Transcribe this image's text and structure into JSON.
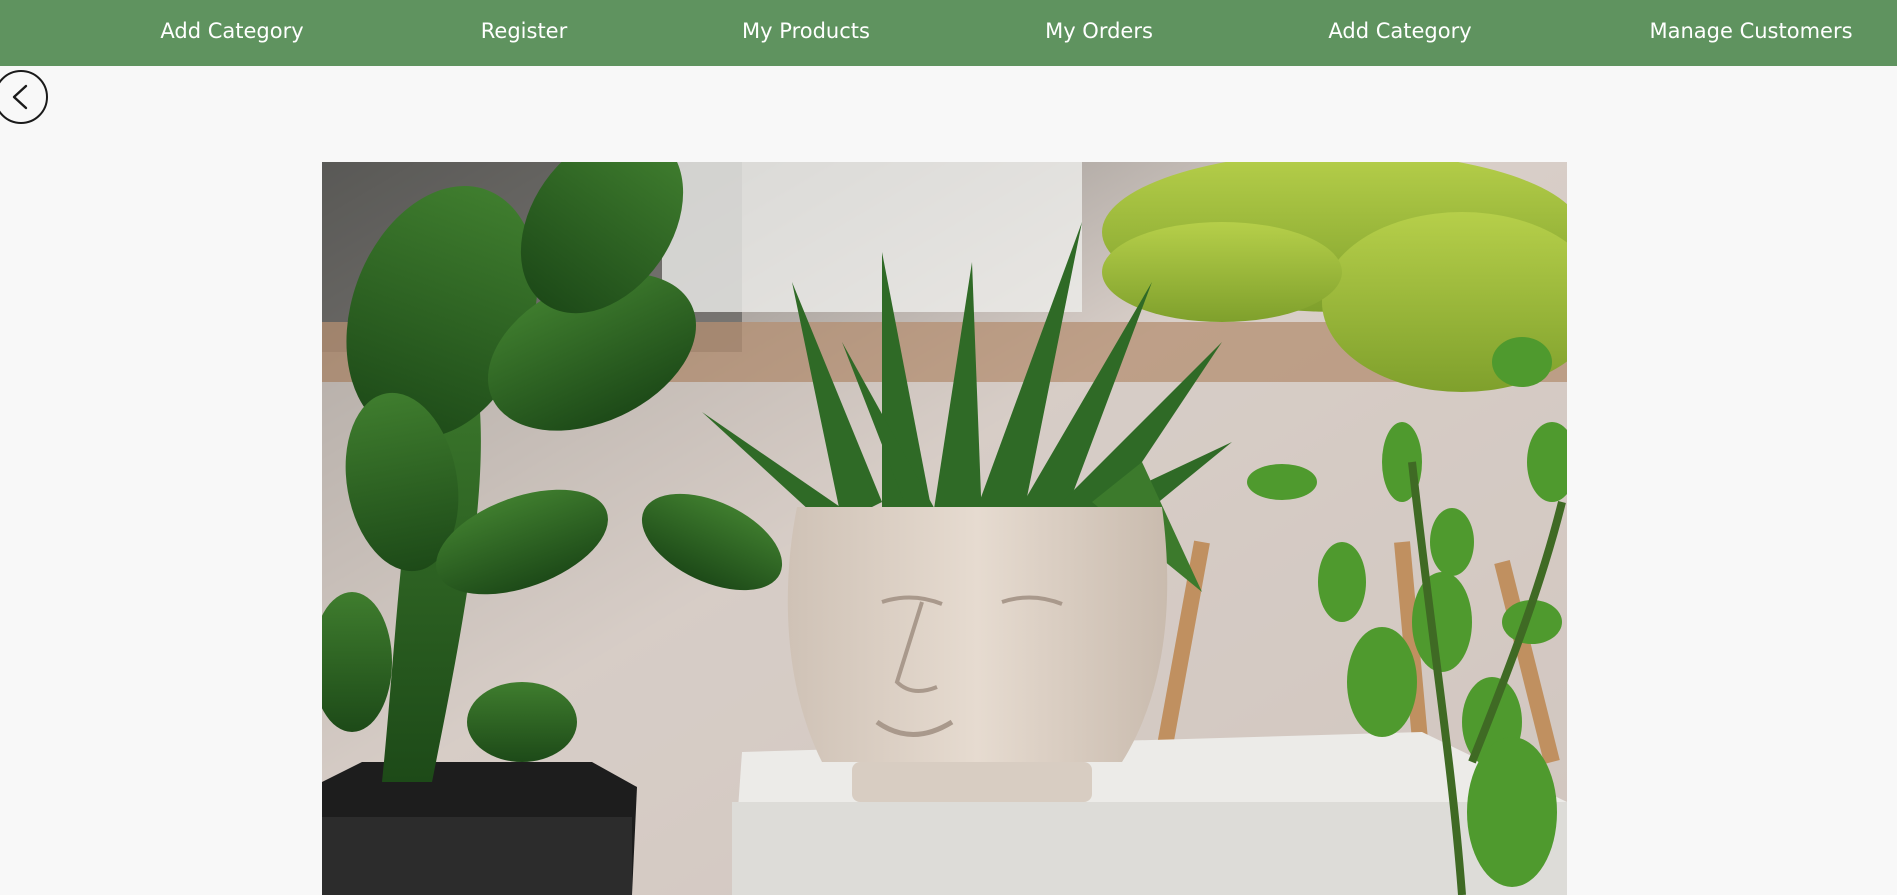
{
  "nav": {
    "items": [
      {
        "label": "Add Category"
      },
      {
        "label": "Register"
      },
      {
        "label": "My Products"
      },
      {
        "label": "My Orders"
      },
      {
        "label": "Add Category"
      },
      {
        "label": "Manage Customers"
      }
    ]
  },
  "back_button": {
    "icon": "chevron-left-icon"
  },
  "colors": {
    "navbar": "#5f935f",
    "page_background": "#f8f8f8",
    "nav_text": "#ffffff"
  },
  "hero_image": {
    "icon": "plants-photo"
  }
}
